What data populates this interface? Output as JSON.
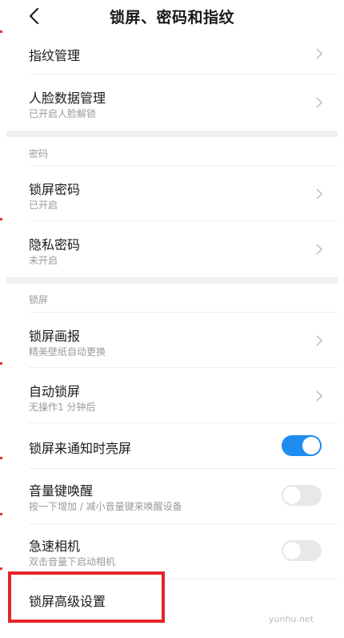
{
  "header": {
    "title": "锁屏、密码和指纹"
  },
  "rows": {
    "fingerprint": {
      "title": "指纹管理"
    },
    "face": {
      "title": "人脸数据管理",
      "subtitle": "已开启人脸解锁"
    },
    "lock_password": {
      "title": "锁屏密码",
      "subtitle": "已开启"
    },
    "privacy_password": {
      "title": "隐私密码",
      "subtitle": "未开启"
    },
    "lock_pictorial": {
      "title": "锁屏画报",
      "subtitle": "精美壁纸自动更换"
    },
    "auto_lock": {
      "title": "自动锁屏",
      "subtitle": "无操作1 分钟后"
    },
    "notify_wake": {
      "title": "锁屏来通知时亮屏",
      "toggle_on": true
    },
    "volume_wake": {
      "title": "音量键唤醒",
      "subtitle": "按一下增加 / 减小音量键来唤醒设备",
      "toggle_on": false
    },
    "quick_camera": {
      "title": "急速相机",
      "subtitle": "双击音量下启动相机",
      "toggle_on": false
    },
    "advanced": {
      "title": "锁屏高级设置"
    }
  },
  "sections": {
    "password": "密码",
    "lockscreen": "锁屏"
  },
  "watermark": "yunhu.net",
  "colors": {
    "accent": "#1f8cf0",
    "highlight": "#e4242a"
  },
  "icons": {
    "back": "chevron-left-icon",
    "row_arrow": "chevron-right-icon"
  }
}
